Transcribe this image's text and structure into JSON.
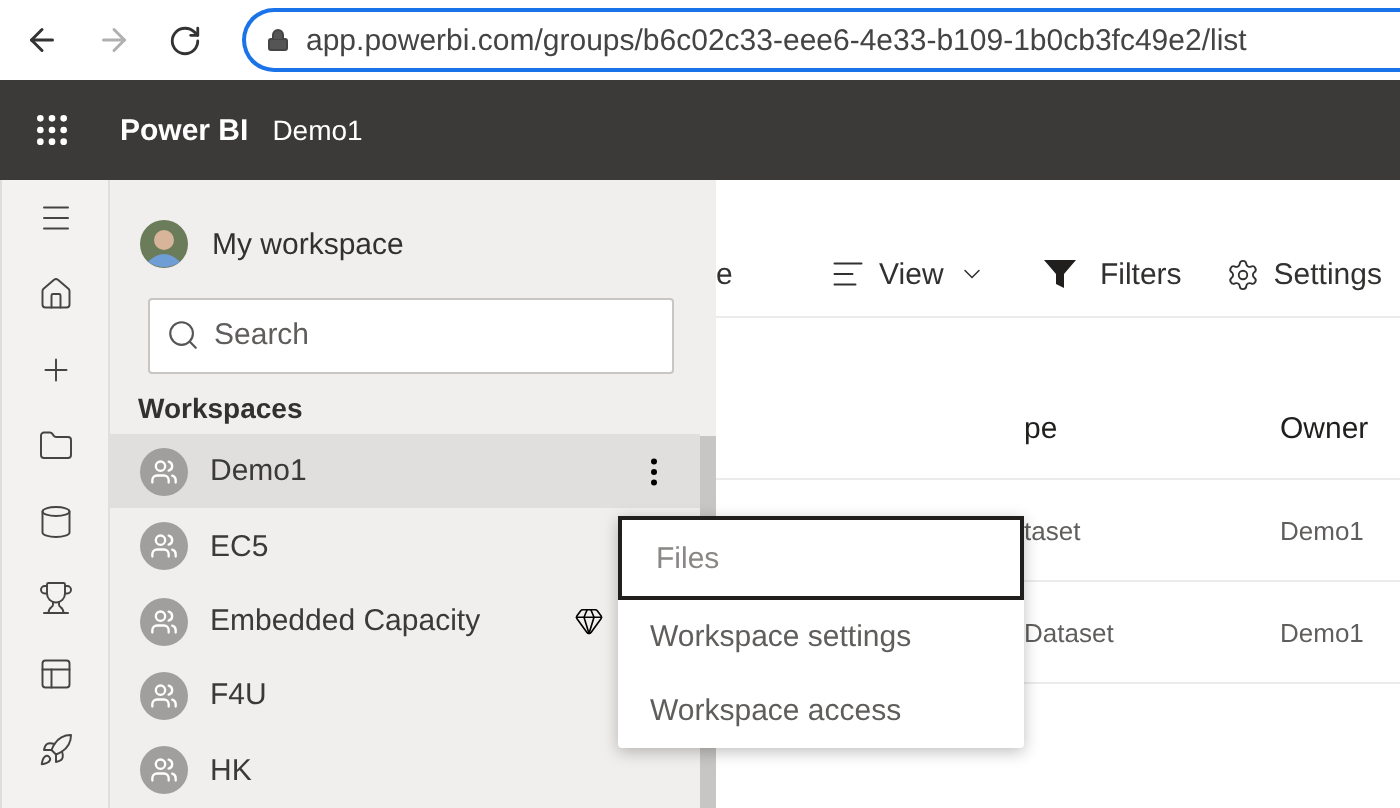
{
  "browser": {
    "url": "app.powerbi.com/groups/b6c02c33-eee6-4e33-b109-1b0cb3fc49e2/list"
  },
  "header": {
    "app_name": "Power BI",
    "workspace": "Demo1"
  },
  "flyout": {
    "my_workspace": "My workspace",
    "search": {
      "placeholder": "Search"
    },
    "section": "Workspaces",
    "items": [
      {
        "name": "Demo1",
        "selected": true,
        "premium": false
      },
      {
        "name": "EC5",
        "selected": false,
        "premium": false
      },
      {
        "name": "Embedded Capacity",
        "selected": false,
        "premium": true
      },
      {
        "name": "F4U",
        "selected": false,
        "premium": false
      },
      {
        "name": "HK",
        "selected": false,
        "premium": false
      }
    ]
  },
  "toolbar": {
    "cut_label": "e",
    "view": "View",
    "filters": "Filters",
    "settings": "Settings"
  },
  "table": {
    "columns": [
      "pe",
      "Owner"
    ],
    "rows": [
      [
        "taset",
        "Demo1"
      ],
      [
        "Dataset",
        "Demo1"
      ]
    ]
  },
  "context_menu": {
    "items": [
      {
        "label": "Files",
        "selected": true
      },
      {
        "label": "Workspace settings",
        "selected": false
      },
      {
        "label": "Workspace access",
        "selected": false
      }
    ]
  }
}
